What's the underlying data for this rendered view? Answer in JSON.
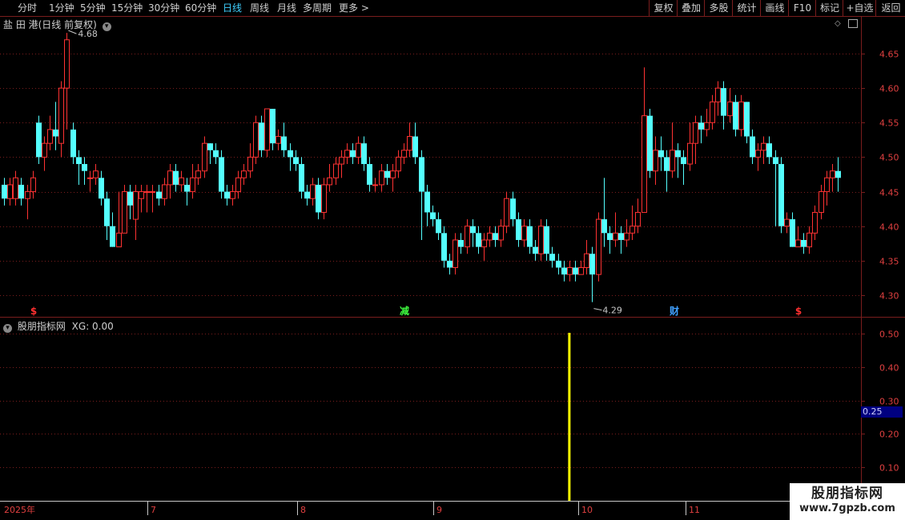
{
  "toolbar": {
    "periods": [
      "分时",
      "1分钟",
      "5分钟",
      "15分钟",
      "30分钟",
      "60分钟",
      "日线",
      "周线",
      "月线",
      "多周期",
      "更多 >"
    ],
    "active_period": "日线",
    "right_buttons": [
      "复权",
      "叠加",
      "多股",
      "统计",
      "画线",
      "F10",
      "标记",
      "+自选",
      "返回"
    ]
  },
  "price_panel": {
    "title": "盐 田 港(日线 前复权)",
    "high_marker": "4.68",
    "low_marker": "4.29",
    "y_ticks": [
      "4.65",
      "4.60",
      "4.55",
      "4.50",
      "4.45",
      "4.40",
      "4.35",
      "4.30"
    ],
    "events": [
      {
        "text": "$",
        "color": "#ff3030"
      },
      {
        "text": "减",
        "color": "#40ff40"
      },
      {
        "text": "财",
        "color": "#40a0ff"
      },
      {
        "text": "$",
        "color": "#ff3030"
      }
    ]
  },
  "indicator_panel": {
    "title": "股朋指标网",
    "value_label": "XG: 0.00",
    "y_ticks": [
      "0.50",
      "0.40",
      "0.30",
      "0.20",
      "0.10"
    ],
    "marker_value": "0.25"
  },
  "x_axis": {
    "labels": [
      "2025年",
      "7",
      "8",
      "9",
      "10",
      "11"
    ]
  },
  "watermark": {
    "title": "股朋指标网",
    "url": "www.7gpzb.com"
  },
  "colors": {
    "up": "#ff3232",
    "down": "#54ffff",
    "grid": "#7a1d1d",
    "signal": "#ffff00"
  },
  "chart_data": [
    {
      "type": "candlestick",
      "title": "盐 田 港(日线 前复权)",
      "ylim": [
        4.28,
        4.7
      ],
      "y_ticks": [
        4.3,
        4.35,
        4.4,
        4.45,
        4.5,
        4.55,
        4.6,
        4.65
      ],
      "annotations": {
        "high": 4.68,
        "low": 4.29
      },
      "candles": [
        [
          4.46,
          4.44,
          4.47,
          4.43
        ],
        [
          4.44,
          4.46,
          4.47,
          4.43
        ],
        [
          4.44,
          4.47,
          4.48,
          4.43
        ],
        [
          4.46,
          4.44,
          4.47,
          4.43
        ],
        [
          4.44,
          4.45,
          4.46,
          4.41
        ],
        [
          4.45,
          4.47,
          4.48,
          4.44
        ],
        [
          4.55,
          4.5,
          4.56,
          4.49
        ],
        [
          4.5,
          4.52,
          4.53,
          4.48
        ],
        [
          4.52,
          4.54,
          4.56,
          4.51
        ],
        [
          4.54,
          4.53,
          4.58,
          4.51
        ],
        [
          4.52,
          4.6,
          4.61,
          4.5
        ],
        [
          4.6,
          4.67,
          4.68,
          4.54
        ],
        [
          4.54,
          4.5,
          4.55,
          4.49
        ],
        [
          4.5,
          4.49,
          4.51,
          4.46
        ],
        [
          4.49,
          4.48,
          4.5,
          4.46
        ],
        [
          4.47,
          4.47,
          4.48,
          4.45
        ],
        [
          4.47,
          4.48,
          4.49,
          4.46
        ],
        [
          4.47,
          4.44,
          4.48,
          4.43
        ],
        [
          4.44,
          4.4,
          4.45,
          4.38
        ],
        [
          4.4,
          4.37,
          4.42,
          4.37
        ],
        [
          4.37,
          4.39,
          4.45,
          4.37
        ],
        [
          4.39,
          4.45,
          4.46,
          4.39
        ],
        [
          4.45,
          4.43,
          4.46,
          4.41
        ],
        [
          4.41,
          4.45,
          4.46,
          4.38
        ],
        [
          4.44,
          4.45,
          4.46,
          4.42
        ],
        [
          4.45,
          4.45,
          4.46,
          4.42
        ],
        [
          4.45,
          4.45,
          4.46,
          4.42
        ],
        [
          4.45,
          4.44,
          4.46,
          4.43
        ],
        [
          4.44,
          4.46,
          4.47,
          4.43
        ],
        [
          4.46,
          4.48,
          4.49,
          4.44
        ],
        [
          4.48,
          4.46,
          4.49,
          4.45
        ],
        [
          4.46,
          4.47,
          4.48,
          4.45
        ],
        [
          4.46,
          4.45,
          4.47,
          4.43
        ],
        [
          4.45,
          4.47,
          4.49,
          4.44
        ],
        [
          4.47,
          4.48,
          4.49,
          4.46
        ],
        [
          4.48,
          4.52,
          4.53,
          4.47
        ],
        [
          4.52,
          4.51,
          4.52,
          4.49
        ],
        [
          4.51,
          4.5,
          4.52,
          4.49
        ],
        [
          4.5,
          4.45,
          4.51,
          4.44
        ],
        [
          4.45,
          4.44,
          4.46,
          4.43
        ],
        [
          4.44,
          4.45,
          4.46,
          4.43
        ],
        [
          4.45,
          4.47,
          4.48,
          4.44
        ],
        [
          4.47,
          4.48,
          4.49,
          4.46
        ],
        [
          4.48,
          4.5,
          4.52,
          4.47
        ],
        [
          4.5,
          4.55,
          4.56,
          4.49
        ],
        [
          4.55,
          4.51,
          4.56,
          4.5
        ],
        [
          4.51,
          4.57,
          4.57,
          4.5
        ],
        [
          4.57,
          4.52,
          4.57,
          4.51
        ],
        [
          4.52,
          4.53,
          4.54,
          4.51
        ],
        [
          4.53,
          4.51,
          4.55,
          4.5
        ],
        [
          4.51,
          4.5,
          4.52,
          4.48
        ],
        [
          4.5,
          4.49,
          4.51,
          4.48
        ],
        [
          4.49,
          4.45,
          4.5,
          4.44
        ],
        [
          4.45,
          4.44,
          4.46,
          4.43
        ],
        [
          4.44,
          4.46,
          4.47,
          4.43
        ],
        [
          4.46,
          4.42,
          4.47,
          4.41
        ],
        [
          4.42,
          4.46,
          4.47,
          4.41
        ],
        [
          4.46,
          4.47,
          4.49,
          4.45
        ],
        [
          4.47,
          4.49,
          4.5,
          4.46
        ],
        [
          4.49,
          4.5,
          4.51,
          4.47
        ],
        [
          4.5,
          4.51,
          4.52,
          4.49
        ],
        [
          4.51,
          4.5,
          4.52,
          4.49
        ],
        [
          4.5,
          4.52,
          4.53,
          4.49
        ],
        [
          4.52,
          4.49,
          4.53,
          4.48
        ],
        [
          4.49,
          4.46,
          4.5,
          4.45
        ],
        [
          4.46,
          4.46,
          4.47,
          4.45
        ],
        [
          4.46,
          4.48,
          4.49,
          4.45
        ],
        [
          4.48,
          4.47,
          4.49,
          4.46
        ],
        [
          4.47,
          4.48,
          4.49,
          4.45
        ],
        [
          4.48,
          4.5,
          4.51,
          4.47
        ],
        [
          4.5,
          4.51,
          4.52,
          4.49
        ],
        [
          4.51,
          4.53,
          4.55,
          4.5
        ],
        [
          4.53,
          4.5,
          4.55,
          4.49
        ],
        [
          4.5,
          4.45,
          4.51,
          4.38
        ],
        [
          4.45,
          4.42,
          4.46,
          4.4
        ],
        [
          4.42,
          4.41,
          4.43,
          4.4
        ],
        [
          4.41,
          4.39,
          4.42,
          4.38
        ],
        [
          4.39,
          4.35,
          4.4,
          4.34
        ],
        [
          4.35,
          4.34,
          4.36,
          4.33
        ],
        [
          4.34,
          4.38,
          4.39,
          4.33
        ],
        [
          4.38,
          4.37,
          4.39,
          4.36
        ],
        [
          4.37,
          4.4,
          4.41,
          4.36
        ],
        [
          4.4,
          4.39,
          4.41,
          4.37
        ],
        [
          4.39,
          4.37,
          4.4,
          4.36
        ],
        [
          4.37,
          4.38,
          4.39,
          4.35
        ],
        [
          4.38,
          4.39,
          4.4,
          4.37
        ],
        [
          4.39,
          4.38,
          4.4,
          4.37
        ],
        [
          4.38,
          4.4,
          4.41,
          4.37
        ],
        [
          4.4,
          4.44,
          4.45,
          4.39
        ],
        [
          4.44,
          4.41,
          4.45,
          4.4
        ],
        [
          4.41,
          4.38,
          4.42,
          4.37
        ],
        [
          4.38,
          4.4,
          4.41,
          4.37
        ],
        [
          4.4,
          4.37,
          4.41,
          4.36
        ],
        [
          4.37,
          4.36,
          4.38,
          4.35
        ],
        [
          4.36,
          4.4,
          4.41,
          4.35
        ],
        [
          4.4,
          4.36,
          4.41,
          4.35
        ],
        [
          4.36,
          4.35,
          4.37,
          4.34
        ],
        [
          4.35,
          4.34,
          4.36,
          4.33
        ],
        [
          4.34,
          4.33,
          4.35,
          4.32
        ],
        [
          4.33,
          4.34,
          4.35,
          4.32
        ],
        [
          4.34,
          4.33,
          4.35,
          4.32
        ],
        [
          4.33,
          4.34,
          4.35,
          4.33
        ],
        [
          4.34,
          4.36,
          4.38,
          4.33
        ],
        [
          4.36,
          4.33,
          4.37,
          4.29
        ],
        [
          4.33,
          4.41,
          4.42,
          4.32
        ],
        [
          4.41,
          4.39,
          4.47,
          4.37
        ],
        [
          4.39,
          4.38,
          4.4,
          4.36
        ],
        [
          4.38,
          4.39,
          4.42,
          4.37
        ],
        [
          4.39,
          4.38,
          4.4,
          4.36
        ],
        [
          4.38,
          4.39,
          4.41,
          4.37
        ],
        [
          4.39,
          4.4,
          4.43,
          4.38
        ],
        [
          4.4,
          4.42,
          4.44,
          4.39
        ],
        [
          4.42,
          4.56,
          4.63,
          4.49
        ],
        [
          4.56,
          4.48,
          4.57,
          4.47
        ],
        [
          4.48,
          4.51,
          4.53,
          4.46
        ],
        [
          4.51,
          4.5,
          4.53,
          4.48
        ],
        [
          4.5,
          4.48,
          4.51,
          4.45
        ],
        [
          4.48,
          4.51,
          4.55,
          4.47
        ],
        [
          4.51,
          4.5,
          4.52,
          4.47
        ],
        [
          4.5,
          4.49,
          4.51,
          4.46
        ],
        [
          4.49,
          4.52,
          4.55,
          4.48
        ],
        [
          4.52,
          4.55,
          4.56,
          4.49
        ],
        [
          4.55,
          4.54,
          4.56,
          4.52
        ],
        [
          4.54,
          4.55,
          4.57,
          4.53
        ],
        [
          4.55,
          4.58,
          4.59,
          4.54
        ],
        [
          4.58,
          4.6,
          4.61,
          4.56
        ],
        [
          4.6,
          4.56,
          4.61,
          4.54
        ],
        [
          4.56,
          4.58,
          4.6,
          4.55
        ],
        [
          4.58,
          4.54,
          4.59,
          4.53
        ],
        [
          4.54,
          4.58,
          4.59,
          4.53
        ],
        [
          4.58,
          4.53,
          4.58,
          4.52
        ],
        [
          4.53,
          4.5,
          4.54,
          4.49
        ],
        [
          4.5,
          4.51,
          4.52,
          4.48
        ],
        [
          4.51,
          4.52,
          4.53,
          4.49
        ],
        [
          4.52,
          4.5,
          4.53,
          4.49
        ],
        [
          4.5,
          4.49,
          4.51,
          4.4
        ],
        [
          4.49,
          4.4,
          4.5,
          4.39
        ],
        [
          4.4,
          4.41,
          4.42,
          4.39
        ],
        [
          4.41,
          4.37,
          4.42,
          4.37
        ],
        [
          4.37,
          4.38,
          4.4,
          4.37
        ],
        [
          4.38,
          4.37,
          4.39,
          4.36
        ],
        [
          4.37,
          4.39,
          4.4,
          4.36
        ],
        [
          4.39,
          4.42,
          4.43,
          4.38
        ],
        [
          4.42,
          4.45,
          4.46,
          4.41
        ],
        [
          4.45,
          4.47,
          4.48,
          4.43
        ],
        [
          4.47,
          4.48,
          4.49,
          4.45
        ],
        [
          4.48,
          4.47,
          4.5,
          4.45
        ]
      ]
    },
    {
      "type": "bar",
      "title": "股朋指标网",
      "series": [
        {
          "name": "XG",
          "values": [
            {
              "x_index": 99,
              "value": 1
            }
          ]
        }
      ],
      "y_ticks": [
        0.1,
        0.2,
        0.3,
        0.4,
        0.5
      ],
      "ylim": [
        0.0,
        0.55
      ],
      "marker_value": 0.25
    }
  ]
}
